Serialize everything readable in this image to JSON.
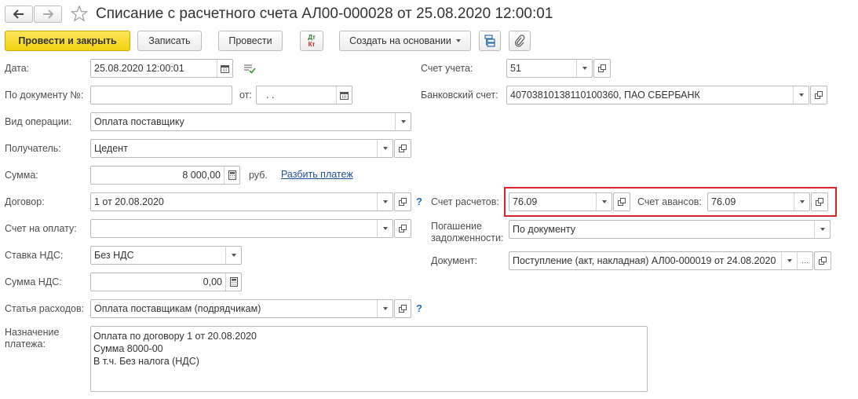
{
  "header": {
    "title": "Списание с расчетного счета АЛ00-000028 от 25.08.2020 12:00:01"
  },
  "toolbar": {
    "post_close": "Провести и закрыть",
    "write": "Записать",
    "post": "Провести",
    "dt_kt_top": "Дт",
    "dt_kt_bottom": "Кт",
    "create_based": "Создать на основании"
  },
  "form": {
    "date_label": "Дата:",
    "date_value": "25.08.2020 12:00:01",
    "docnum_label": "По документу №:",
    "docnum_value": "",
    "from_label": "от:",
    "from_value": " .  .",
    "optype_label": "Вид операции:",
    "optype_value": "Оплата поставщику",
    "recipient_label": "Получатель:",
    "recipient_value": "Цедент",
    "sum_label": "Сумма:",
    "sum_value": "8 000,00",
    "currency": "руб.",
    "split_link": "Разбить платеж",
    "contract_label": "Договор:",
    "contract_value": "1 от 20.08.2020",
    "invoice_label": "Счет на оплату:",
    "invoice_value": "",
    "vat_rate_label": "Ставка НДС:",
    "vat_rate_value": "Без НДС",
    "vat_sum_label": "Сумма НДС:",
    "vat_sum_value": "0,00",
    "expense_label": "Статья расходов:",
    "expense_value": "Оплата поставщикам (подрядчикам)",
    "purpose_label_1": "Назначение",
    "purpose_label_2": "платежа:",
    "purpose_lines": [
      "Оплата по договору 1 от 20.08.2020",
      "Сумма 8000-00",
      "В т.ч. Без налога (НДС)"
    ],
    "account_label": "Счет учета:",
    "account_value": "51",
    "bank_label": "Банковский счет:",
    "bank_value": "40703810138110100360, ПАО СБЕРБАНК",
    "settle_label": "Счет расчетов:",
    "settle_value": "76.09",
    "advance_label": "Счет авансов:",
    "advance_value": "76.09",
    "repay_label_1": "Погашение",
    "repay_label_2": "задолженности:",
    "repay_value": "По документу",
    "document_label": "Документ:",
    "document_value": "Поступление (акт, накладная) АЛ00-000019 от 24.08.2020",
    "help_mark": "?"
  },
  "colors": {
    "highlight": "#d9252a",
    "primary_button": "#f3d10f",
    "link": "#1c4f9a"
  }
}
